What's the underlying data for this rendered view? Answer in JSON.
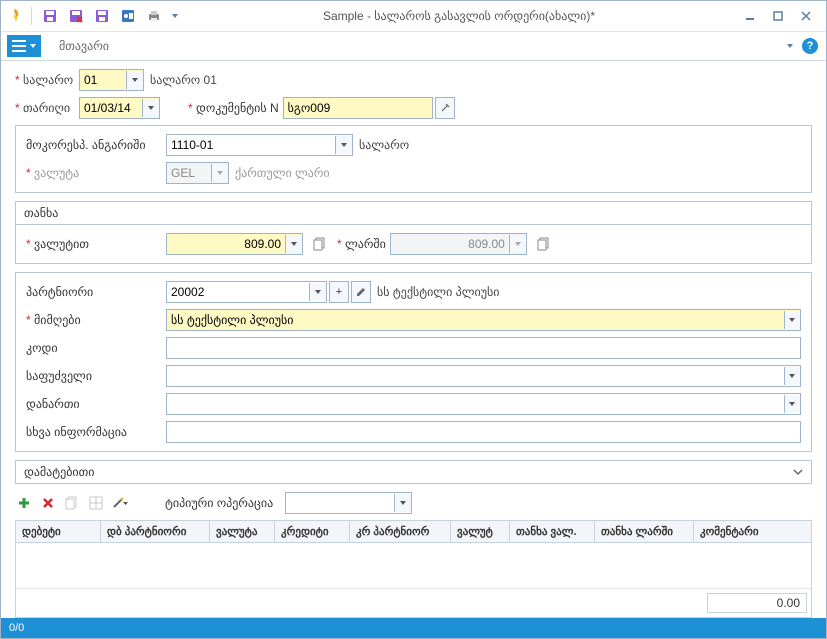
{
  "title": "Sample - სალაროს გასავლის ორდერი(ახალი)*",
  "ribbon_tab": "მთავარი",
  "toprow": {
    "salaro_label": "სალარო",
    "salaro_value": "01",
    "salaro_after": "სალარო 01",
    "date_label": "თარიღი",
    "date_value": "01/03/14",
    "doc_label": "დოკუმენტის N",
    "doc_value": "სგო009"
  },
  "acct": {
    "account_label": "მოკორესპ. ანგარიში",
    "account_value": "1110-01",
    "account_after": "სალარო",
    "currency_label": "ვალუტა",
    "currency_value": "GEL",
    "currency_after": "ქართული ლარი"
  },
  "amount": {
    "header": "თანხა",
    "cur_label": "ვალუტით",
    "cur_value": "809.00",
    "gel_label": "ლარში",
    "gel_value": "809.00"
  },
  "partner": {
    "partner_label": "პარტნიორი",
    "partner_value": "20002",
    "partner_after": "სს ტექსტილი პლიუსი",
    "recipient_label": "მიმღები",
    "recipient_value": "სს ტექსტილი პლიუსი",
    "code_label": "კოდი",
    "code_value": "",
    "basis_label": "საფუძველი",
    "basis_value": "",
    "attach_label": "დანართი",
    "attach_value": "",
    "other_label": "სხვა ინფორმაცია",
    "other_value": ""
  },
  "expander": "დამატებითი",
  "typical_label": "ტიპიური ოპერაცია",
  "grid_headers": [
    "დებეტი",
    "დბ პარტნიორი",
    "ვალუტა",
    "კრედიტი",
    "კრ პარტნიორ",
    "ვალუტ",
    "თანხა ვალ.",
    "თანხა ლარში",
    "კომენტარი"
  ],
  "grid_total": "0.00",
  "status": "0/0"
}
